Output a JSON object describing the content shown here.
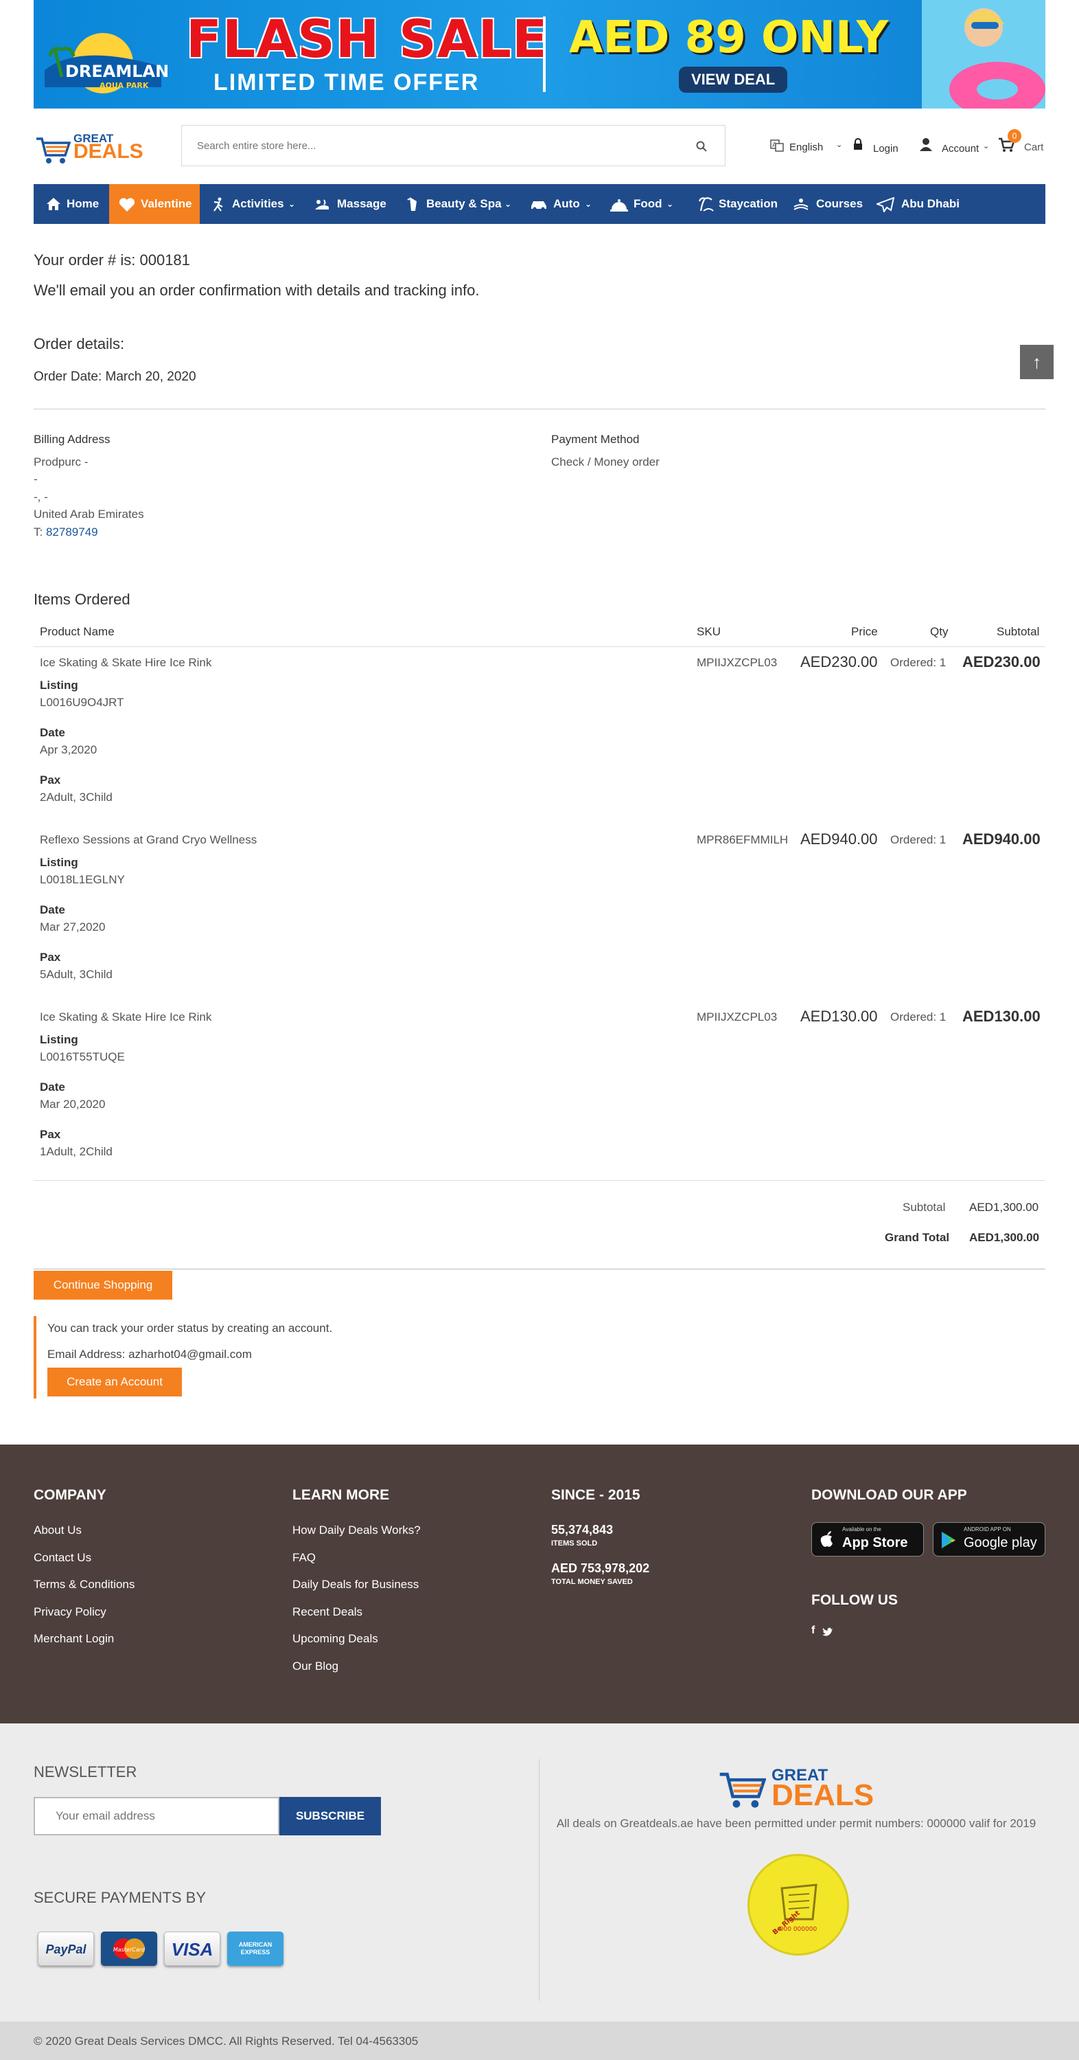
{
  "banner": {
    "brand": "DREAMLAND",
    "brand_sub": "AQUA PARK",
    "headline": "FLASH SALE",
    "subline": "LIMITED TIME OFFER",
    "price": "AED 89 ONLY",
    "cta": "VIEW DEAL"
  },
  "header": {
    "logo_top": "GREAT",
    "logo_bottom": "DEALS",
    "search_placeholder": "Search entire store here...",
    "language": "English",
    "login": "Login",
    "account": "Account",
    "cart": "Cart",
    "cart_count": "0"
  },
  "nav": {
    "items": [
      {
        "label": "Home",
        "icon": "home-icon"
      },
      {
        "label": "Valentine",
        "icon": "heart-icon"
      },
      {
        "label": "Activities",
        "icon": "activity-icon"
      },
      {
        "label": "Massage",
        "icon": "massage-icon"
      },
      {
        "label": "Beauty & Spa",
        "icon": "spa-icon"
      },
      {
        "label": "Auto",
        "icon": "car-icon"
      },
      {
        "label": "Food",
        "icon": "food-icon"
      },
      {
        "label": "Staycation",
        "icon": "staycation-icon"
      },
      {
        "label": "Courses",
        "icon": "courses-icon"
      },
      {
        "label": "Abu Dhabi",
        "icon": "plane-icon"
      }
    ]
  },
  "order": {
    "number_text": "Your order # is: 000181",
    "email_note": "We'll email you an order confirmation with details and tracking info.",
    "details_title": "Order details:",
    "date_text": "Order Date: March 20, 2020",
    "billing_title": "Billing Address",
    "billing_lines": [
      "Prodpurc -",
      "-",
      "-, -",
      "United Arab Emirates"
    ],
    "phone_prefix": "T:",
    "phone": "82789749",
    "payment_title": "Payment Method",
    "payment_value": "Check / Money order"
  },
  "items": {
    "title": "Items Ordered",
    "headers": {
      "product": "Product Name",
      "sku": "SKU",
      "price": "Price",
      "qty": "Qty",
      "subtotal": "Subtotal"
    },
    "rows": [
      {
        "name": "Ice Skating & Skate Hire Ice Rink",
        "sku": "MPIIJXZCPL03",
        "price": "AED230.00",
        "qty": "Ordered: 1",
        "subtotal": "AED230.00",
        "listing_label": "Listing",
        "listing": "L0016U9O4JRT",
        "date_label": "Date",
        "date": "Apr 3,2020",
        "pax_label": "Pax",
        "pax": "2Adult, 3Child"
      },
      {
        "name": "Reflexo Sessions at Grand Cryo Wellness",
        "sku": "MPR86EFMMILH",
        "price": "AED940.00",
        "qty": "Ordered: 1",
        "subtotal": "AED940.00",
        "listing_label": "Listing",
        "listing": "L0018L1EGLNY",
        "date_label": "Date",
        "date": "Mar 27,2020",
        "pax_label": "Pax",
        "pax": "5Adult, 3Child"
      },
      {
        "name": "Ice Skating & Skate Hire Ice Rink",
        "sku": "MPIIJXZCPL03",
        "price": "AED130.00",
        "qty": "Ordered: 1",
        "subtotal": "AED130.00",
        "listing_label": "Listing",
        "listing": "L0016T55TUQE",
        "date_label": "Date",
        "date": "Mar 20,2020",
        "pax_label": "Pax",
        "pax": "1Adult, 2Child"
      }
    ],
    "subtotal_label": "Subtotal",
    "subtotal_value": "AED1,300.00",
    "grand_label": "Grand Total",
    "grand_value": "AED1,300.00"
  },
  "actions": {
    "continue": "Continue Shopping",
    "track_note": "You can track your order status by creating an account.",
    "email_line": "Email Address: azharhot04@gmail.com",
    "create_account": "Create an Account"
  },
  "footer": {
    "company_title": "COMPANY",
    "company_links": [
      "About Us",
      "Contact Us",
      "Terms & Conditions",
      "Privacy Policy",
      "Merchant Login"
    ],
    "learn_title": "LEARN MORE",
    "learn_links": [
      "How Daily Deals Works?",
      "FAQ",
      "Daily Deals for Business",
      "Recent Deals",
      "Upcoming Deals",
      "Our Blog"
    ],
    "since_title": "SINCE - 2015",
    "items_sold": "55,374,843",
    "items_sold_label": "ITEMS SOLD",
    "money_saved": "AED 753,978,202",
    "money_saved_label": "TOTAL MONEY SAVED",
    "app_title": "DOWNLOAD OUR APP",
    "appstore_small": "Available on the",
    "appstore": "App Store",
    "googleplay_small": "ANDROID APP ON",
    "googleplay": "Google play",
    "follow_title": "FOLLOW US"
  },
  "lower": {
    "newsletter_title": "NEWSLETTER",
    "email_placeholder": "Your email address",
    "subscribe": "SUBSCRIBE",
    "payments_title": "SECURE PAYMENTS BY",
    "cards": [
      "PayPal",
      "MasterCard",
      "VISA",
      "AMERICAN EXPRESS"
    ],
    "permit_text": "All deals on Greatdeals.ae have been permitted under permit numbers: 000000 valif for 2019",
    "seal_text": "Be Right"
  },
  "copyright": "© 2020 Great Deals Services DMCC. All Rights Reserved. Tel 04-4563305",
  "colors": {
    "brand_blue": "#1f4b8a",
    "brand_orange": "#f58020",
    "footer_bg": "#4d3f3c"
  }
}
